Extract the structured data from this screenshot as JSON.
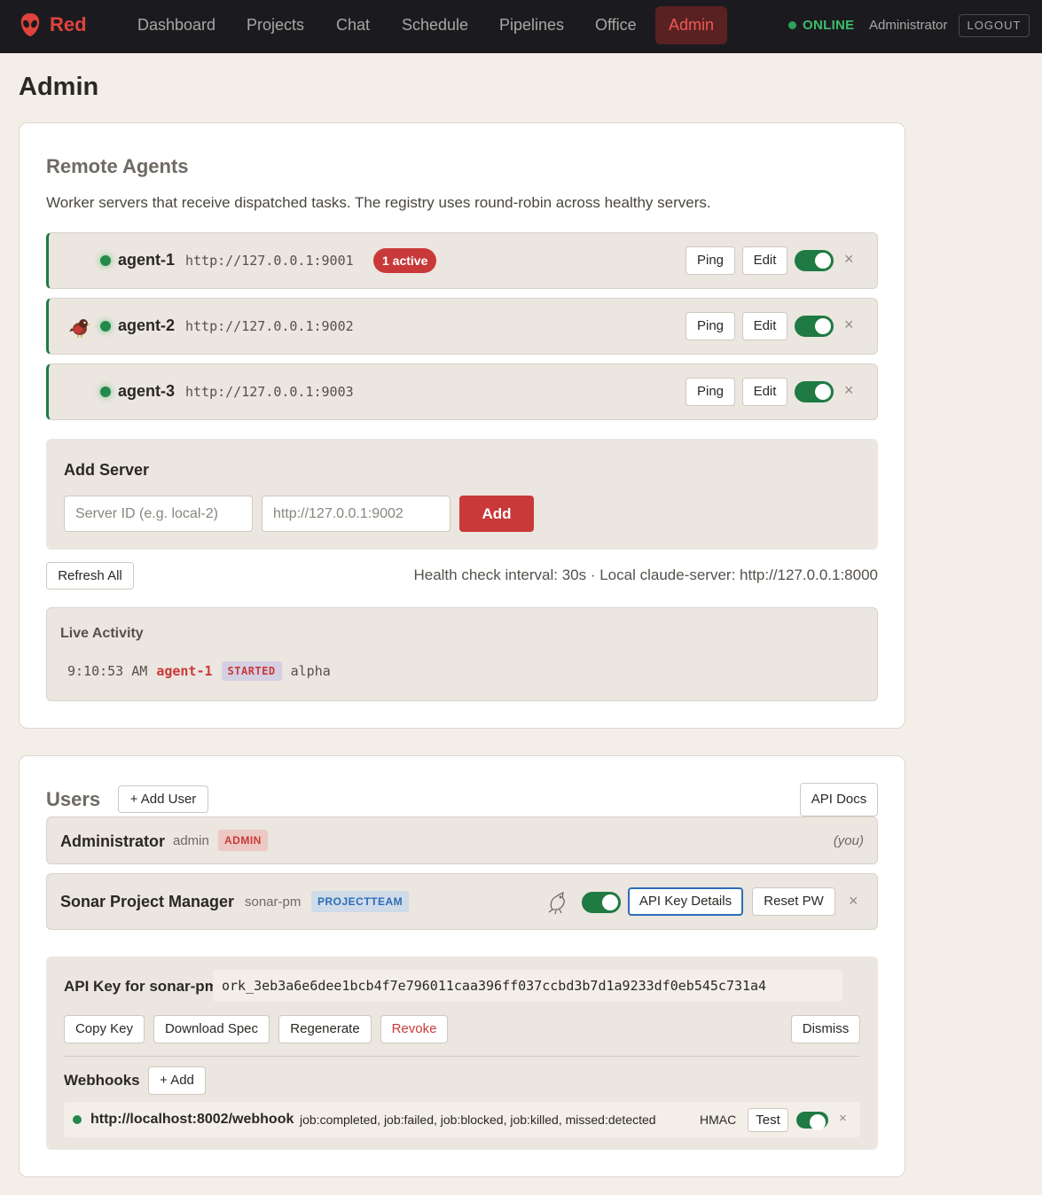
{
  "brand": {
    "name": "Red",
    "logo_icon": "alien-head-icon",
    "accent": "#e0433d"
  },
  "nav": {
    "items": [
      "Dashboard",
      "Projects",
      "Chat",
      "Schedule",
      "Pipelines",
      "Office",
      "Admin"
    ],
    "active": "Admin"
  },
  "header": {
    "status": "ONLINE",
    "user": "Administrator",
    "logout": "LOGOUT"
  },
  "page_title": "Admin",
  "remote_agents": {
    "title": "Remote Agents",
    "description": "Worker servers that receive dispatched tasks. The registry uses round-robin across healthy servers.",
    "agents": [
      {
        "name": "agent-1",
        "url": "http://127.0.0.1:9001",
        "badge": "1 active",
        "avatar": "",
        "enabled": true
      },
      {
        "name": "agent-2",
        "url": "http://127.0.0.1:9002",
        "badge": "",
        "avatar": "bird-icon",
        "enabled": true
      },
      {
        "name": "agent-3",
        "url": "http://127.0.0.1:9003",
        "badge": "",
        "avatar": "",
        "enabled": true
      }
    ],
    "ping_label": "Ping",
    "edit_label": "Edit",
    "remove_label": "×",
    "add_server": {
      "title": "Add Server",
      "id_placeholder": "Server ID (e.g. local-2)",
      "url_placeholder": "http://127.0.0.1:9002",
      "add_label": "Add"
    },
    "refresh_label": "Refresh All",
    "health_text": "Health check interval: 30s · Local claude-server: http://127.0.0.1:8000",
    "activity": {
      "title": "Live Activity",
      "time": "9:10:53 AM",
      "agent": "agent-1",
      "event": "STARTED",
      "target": "alpha"
    }
  },
  "users": {
    "title": "Users",
    "add_label": "+ Add User",
    "api_docs_label": "API Docs",
    "rows": [
      {
        "name": "Administrator",
        "login": "admin",
        "role": "ADMIN",
        "note": "(you)"
      },
      {
        "name": "Sonar Project Manager",
        "login": "sonar-pm",
        "role": "PROJECTTEAM",
        "icon": "bird-outline-icon",
        "enabled": true,
        "details_label": "API Key Details",
        "reset_label": "Reset PW",
        "remove_label": "×"
      }
    ],
    "api_key": {
      "label": "API Key for sonar-pm:",
      "value": "ork_3eb3a6e6dee1bcb4f7e796011caa396ff037ccbd3b7d1a9233df0eb545c731a4",
      "copy": "Copy Key",
      "download": "Download Spec",
      "regenerate": "Regenerate",
      "revoke": "Revoke",
      "dismiss": "Dismiss"
    },
    "webhooks": {
      "title": "Webhooks",
      "add_label": "+ Add",
      "items": [
        {
          "url": "http://localhost:8002/webhook",
          "events": "job:completed, job:failed, job:blocked, job:killed, missed:detected",
          "auth": "HMAC",
          "test_label": "Test",
          "enabled": true,
          "remove_label": "×"
        }
      ]
    }
  }
}
